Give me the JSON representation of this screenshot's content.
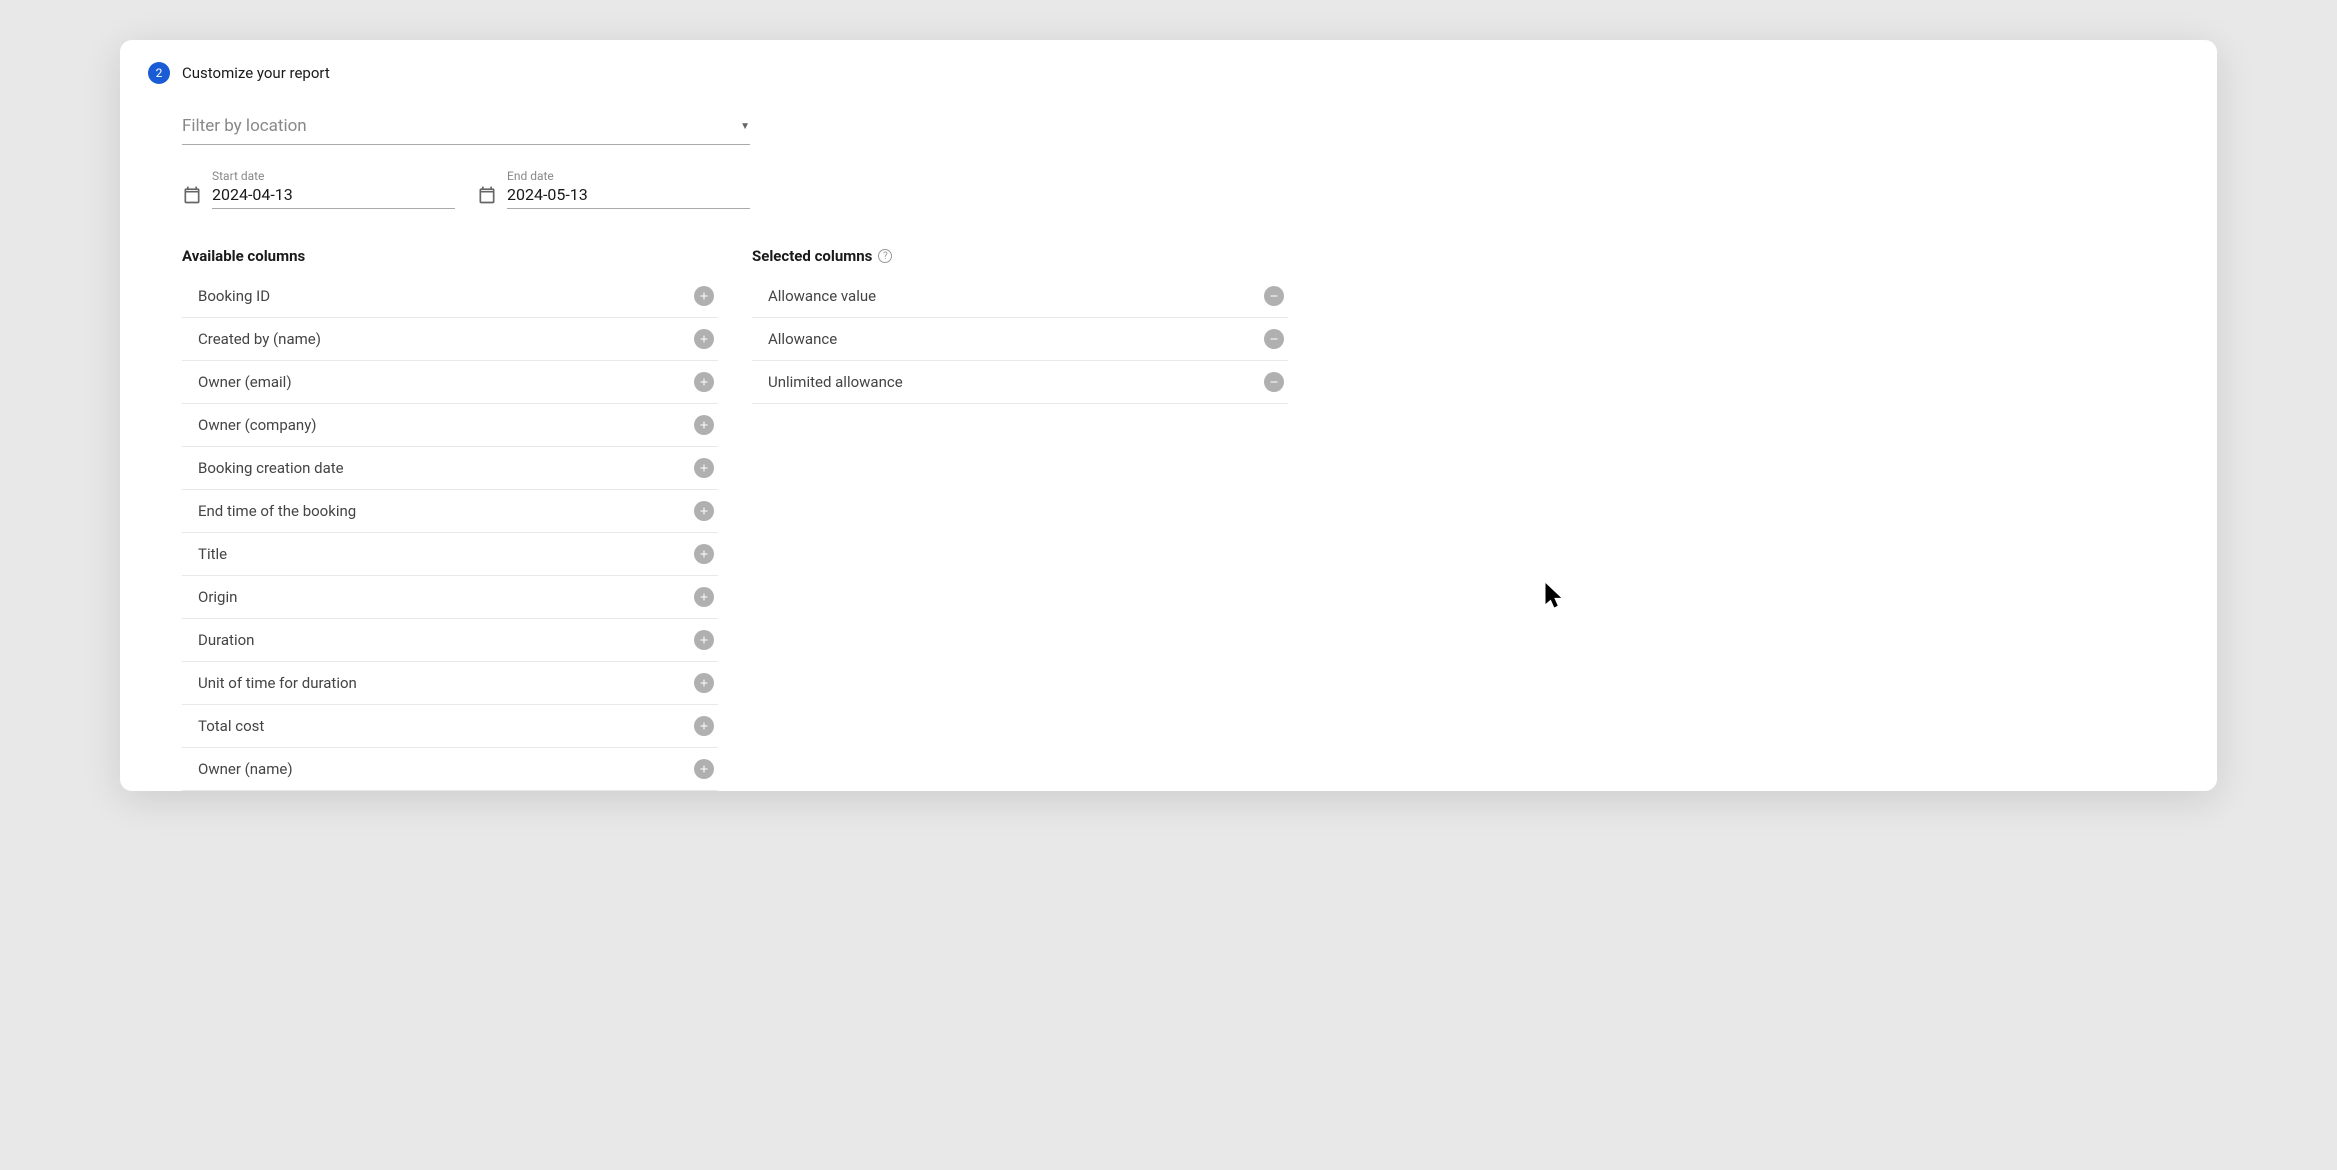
{
  "step": {
    "number": "2",
    "title": "Customize your report"
  },
  "filter": {
    "location_placeholder": "Filter by location"
  },
  "dates": {
    "start_label": "Start date",
    "start_value": "2024-04-13",
    "end_label": "End date",
    "end_value": "2024-05-13"
  },
  "available": {
    "heading": "Available columns",
    "items": [
      "Booking ID",
      "Created by (name)",
      "Owner (email)",
      "Owner (company)",
      "Booking creation date",
      "End time of the booking",
      "Title",
      "Origin",
      "Duration",
      "Unit of time for duration",
      "Total cost",
      "Owner (name)"
    ]
  },
  "selected": {
    "heading": "Selected columns",
    "items": [
      "Allowance value",
      "Allowance",
      "Unlimited allowance"
    ]
  }
}
